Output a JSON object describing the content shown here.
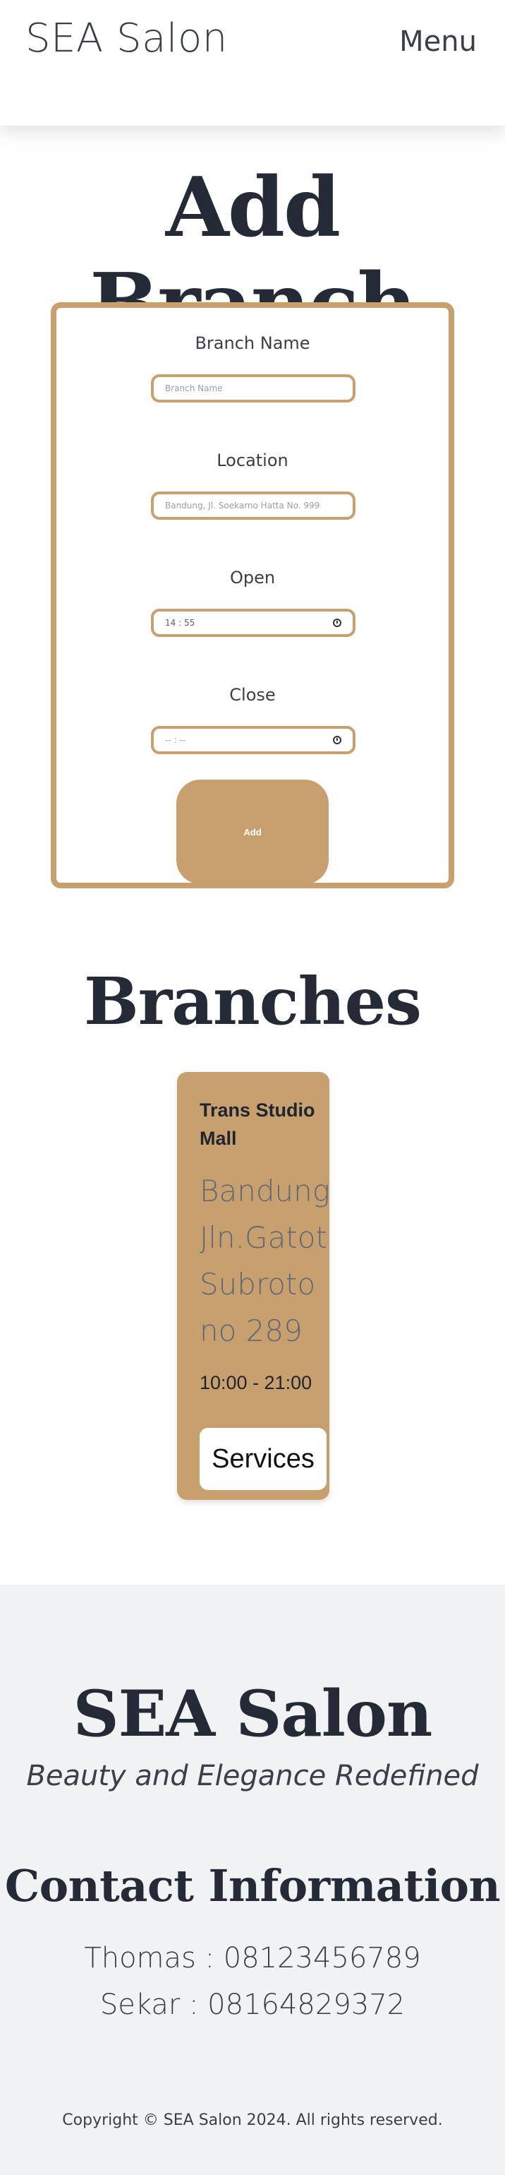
{
  "header": {
    "brand": "SEA Salon",
    "menu_label": "Menu"
  },
  "page_title": "Add Branch",
  "form": {
    "fields": [
      {
        "label": "Branch Name",
        "placeholder": "Branch Name"
      },
      {
        "label": "Location",
        "placeholder": "Bandung, Jl. Soekarno Hatta No. 999"
      },
      {
        "label": "Open",
        "value": "14 : 55"
      },
      {
        "label": "Close",
        "value": "-- : --"
      }
    ],
    "submit_label": "Add"
  },
  "branches_section": {
    "title": "Branches",
    "items": [
      {
        "name": "Trans Studio Mall",
        "location": "Bandung, Jln.Gatot Subroto no 289",
        "hours": "10:00 - 21:00",
        "services_label": "Services"
      }
    ]
  },
  "footer": {
    "brand": "SEA Salon",
    "tagline": "Beauty and Elegance Redefined",
    "contact_title": "Contact Information",
    "contacts": [
      "Thomas : 08123456789",
      "Sekar : 08164829372"
    ],
    "copyright": "Copyright © SEA Salon 2024. All rights reserved."
  },
  "colors": {
    "accent": "#c8a06e",
    "heading": "#252b36",
    "footer_bg": "#f1f2f4"
  },
  "icons": {
    "time_input": "clock-icon"
  }
}
